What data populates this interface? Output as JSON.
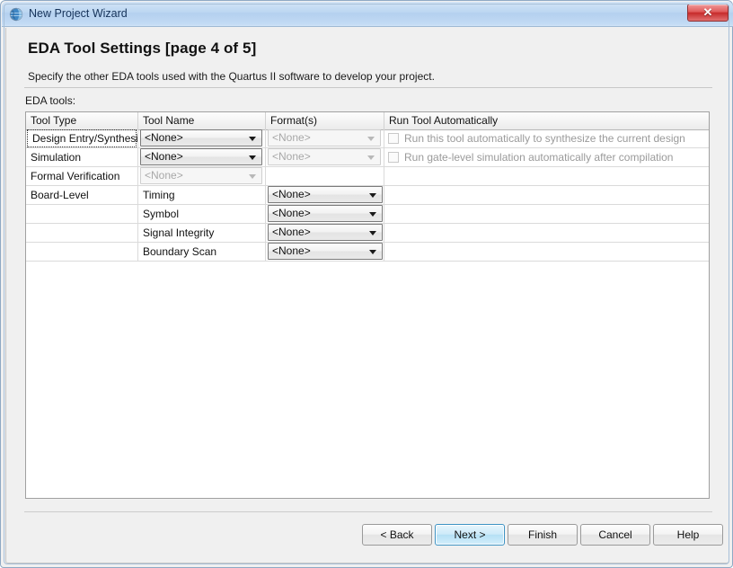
{
  "window": {
    "title": "New Project Wizard",
    "icon": "quartus-globe-icon",
    "close_label": "✕"
  },
  "page": {
    "title": "EDA Tool Settings [page 4 of 5]",
    "description": "Specify the other EDA tools used with the Quartus II software to develop your project.",
    "section_label": "EDA tools:"
  },
  "table": {
    "columns": [
      "Tool Type",
      "Tool Name",
      "Format(s)",
      "Run Tool Automatically"
    ],
    "rows": [
      {
        "tool_type": "Design Entry/Synthesis",
        "tool_type_focused": true,
        "tool_name": "<None>",
        "tool_name_enabled": true,
        "formats": "<None>",
        "formats_enabled": false,
        "run_auto_label": "Run this tool automatically to synthesize the current design",
        "run_auto_checked": false,
        "run_auto_enabled": false
      },
      {
        "tool_type": "Simulation",
        "tool_type_focused": false,
        "tool_name": "<None>",
        "tool_name_enabled": true,
        "formats": "<None>",
        "formats_enabled": false,
        "run_auto_label": "Run gate-level simulation automatically after compilation",
        "run_auto_checked": false,
        "run_auto_enabled": false
      },
      {
        "tool_type": "Formal Verification",
        "tool_type_focused": false,
        "tool_name": "<None>",
        "tool_name_enabled": false,
        "formats": "",
        "formats_enabled": null,
        "run_auto_label": "",
        "run_auto_checked": false,
        "run_auto_enabled": false
      },
      {
        "tool_type": "Board-Level",
        "tool_type_focused": false,
        "tool_name": "Timing",
        "tool_name_enabled": null,
        "formats": "<None>",
        "formats_enabled": true,
        "run_auto_label": "",
        "run_auto_checked": false,
        "run_auto_enabled": false
      },
      {
        "tool_type": "",
        "tool_type_focused": false,
        "tool_name": "Symbol",
        "tool_name_enabled": null,
        "formats": "<None>",
        "formats_enabled": true,
        "run_auto_label": "",
        "run_auto_checked": false,
        "run_auto_enabled": false
      },
      {
        "tool_type": "",
        "tool_type_focused": false,
        "tool_name": "Signal Integrity",
        "tool_name_enabled": null,
        "formats": "<None>",
        "formats_enabled": true,
        "run_auto_label": "",
        "run_auto_checked": false,
        "run_auto_enabled": false
      },
      {
        "tool_type": "",
        "tool_type_focused": false,
        "tool_name": "Boundary Scan",
        "tool_name_enabled": null,
        "formats": "<None>",
        "formats_enabled": true,
        "run_auto_label": "",
        "run_auto_checked": false,
        "run_auto_enabled": false
      }
    ]
  },
  "footer": {
    "buttons": [
      {
        "label": "< Back",
        "default": false
      },
      {
        "label": "Next >",
        "default": true
      },
      {
        "label": "Finish",
        "default": false
      },
      {
        "label": "Cancel",
        "default": false
      },
      {
        "label": "Help",
        "default": false
      }
    ]
  },
  "colors": {
    "titlebar": "#bdd7f2",
    "close_button": "#c62b2b",
    "default_button_border": "#3d93c4",
    "panel_background": "#f0f0f0"
  }
}
